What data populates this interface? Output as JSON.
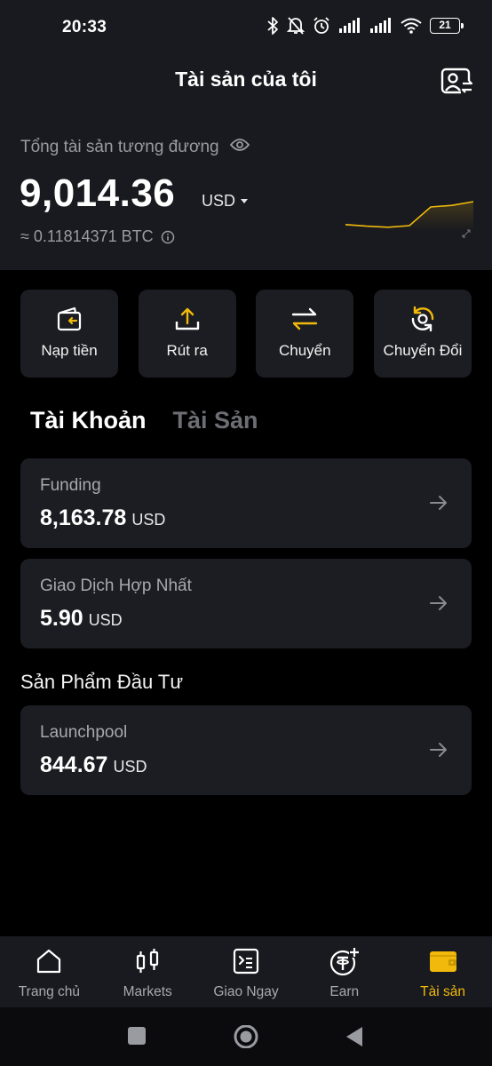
{
  "status_bar": {
    "time": "20:33",
    "battery": "21",
    "icons": [
      "bluetooth-icon",
      "bell-muted-icon",
      "alarm-icon",
      "signal-icon",
      "signal-icon",
      "wifi-icon",
      "battery-icon"
    ]
  },
  "header": {
    "title": "Tài sản của tôi",
    "action_icon": "account-switch-icon"
  },
  "balance": {
    "label": "Tổng tài sản tương đương",
    "value": "9,014.36",
    "currency": "USD",
    "btc_equivalent": "≈ 0.11814371 BTC"
  },
  "actions": [
    {
      "label": "Nạp tiền",
      "icon": "deposit-wallet-icon"
    },
    {
      "label": "Rút ra",
      "icon": "upload-icon"
    },
    {
      "label": "Chuyển",
      "icon": "transfer-arrows-icon"
    },
    {
      "label": "Chuyển Đổi",
      "icon": "convert-icon"
    }
  ],
  "tabs": [
    {
      "label": "Tài Khoản",
      "active": true
    },
    {
      "label": "Tài Sản",
      "active": false
    }
  ],
  "accounts": [
    {
      "name": "Funding",
      "amount": "8,163.78",
      "currency": "USD"
    },
    {
      "name": "Giao Dịch Hợp Nhất",
      "amount": "5.90",
      "currency": "USD"
    }
  ],
  "investment": {
    "title": "Sản Phẩm Đầu Tư",
    "items": [
      {
        "name": "Launchpool",
        "amount": "844.67",
        "currency": "USD"
      }
    ]
  },
  "bottom_nav": [
    {
      "label": "Trang chủ",
      "icon": "home-icon",
      "active": false
    },
    {
      "label": "Markets",
      "icon": "candlestick-icon",
      "active": false
    },
    {
      "label": "Giao Ngay",
      "icon": "terminal-icon",
      "active": false
    },
    {
      "label": "Earn",
      "icon": "tether-plus-icon",
      "active": false
    },
    {
      "label": "Tài sản",
      "icon": "wallet-icon",
      "active": true
    }
  ],
  "colors": {
    "accent": "#f0b90b",
    "background": "#000000",
    "panel": "#191a1f",
    "card": "#1c1d22",
    "muted_text": "#9a9ba1"
  },
  "sparkline": {
    "trend": [
      0.12,
      0.09,
      0.07,
      0.1,
      0.45,
      0.48,
      0.55
    ],
    "color": "#f0b90b"
  }
}
